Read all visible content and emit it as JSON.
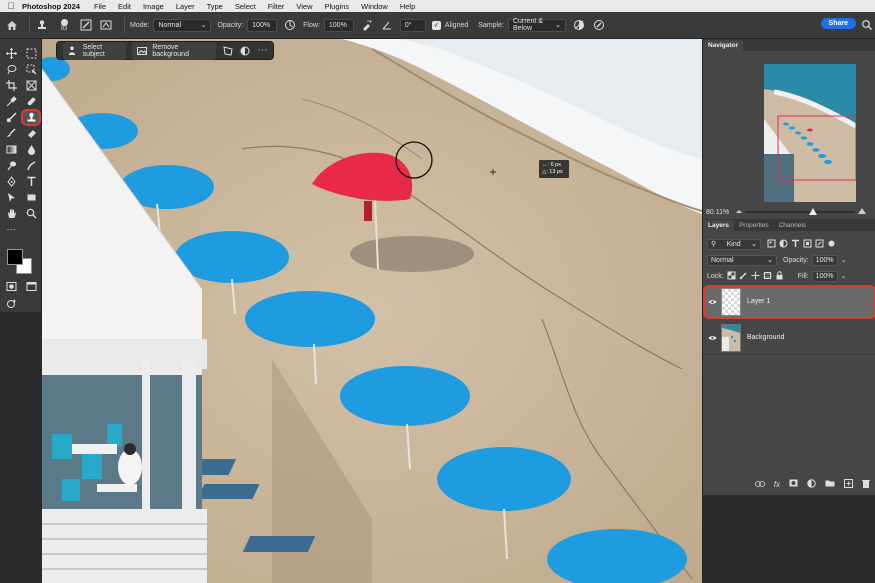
{
  "menubar": {
    "app_name": "Photoshop 2024",
    "items": [
      "File",
      "Edit",
      "Image",
      "Layer",
      "Type",
      "Select",
      "Filter",
      "View",
      "Plugins",
      "Window",
      "Help"
    ]
  },
  "options_bar": {
    "brush_size": "93",
    "mode_label": "Mode:",
    "mode_value": "Normal",
    "opacity_label": "Opacity:",
    "opacity_value": "100%",
    "flow_label": "Flow:",
    "flow_value": "100%",
    "angle_value": "0°",
    "aligned_label": "Aligned",
    "aligned_checked": true,
    "sample_label": "Sample:",
    "sample_value": "Current & Below",
    "share_label": "Share"
  },
  "taskbar": {
    "select_subject": "Select subject",
    "remove_background": "Remove background"
  },
  "readout": {
    "dx": "6 px",
    "dy": "13 px"
  },
  "navigator": {
    "tab": "Navigator",
    "zoom": "80.11%",
    "zoom_fraction": 0.62
  },
  "layers_panel": {
    "tabs": [
      "Layers",
      "Properties",
      "Channels"
    ],
    "filter_value": "Kind",
    "blend_value": "Normal",
    "opacity_label": "Opacity:",
    "opacity_value": "100%",
    "lock_label": "Lock:",
    "fill_label": "Fill:",
    "fill_value": "100%",
    "layers": [
      {
        "name": "Layer 1",
        "selected": true
      },
      {
        "name": "Background",
        "selected": false
      }
    ]
  },
  "colors": {
    "accent_highlight": "#e2392d",
    "umbrella_blue": "#1f9be0",
    "umbrella_red": "#e8294a",
    "share_blue": "#1f6feb"
  }
}
